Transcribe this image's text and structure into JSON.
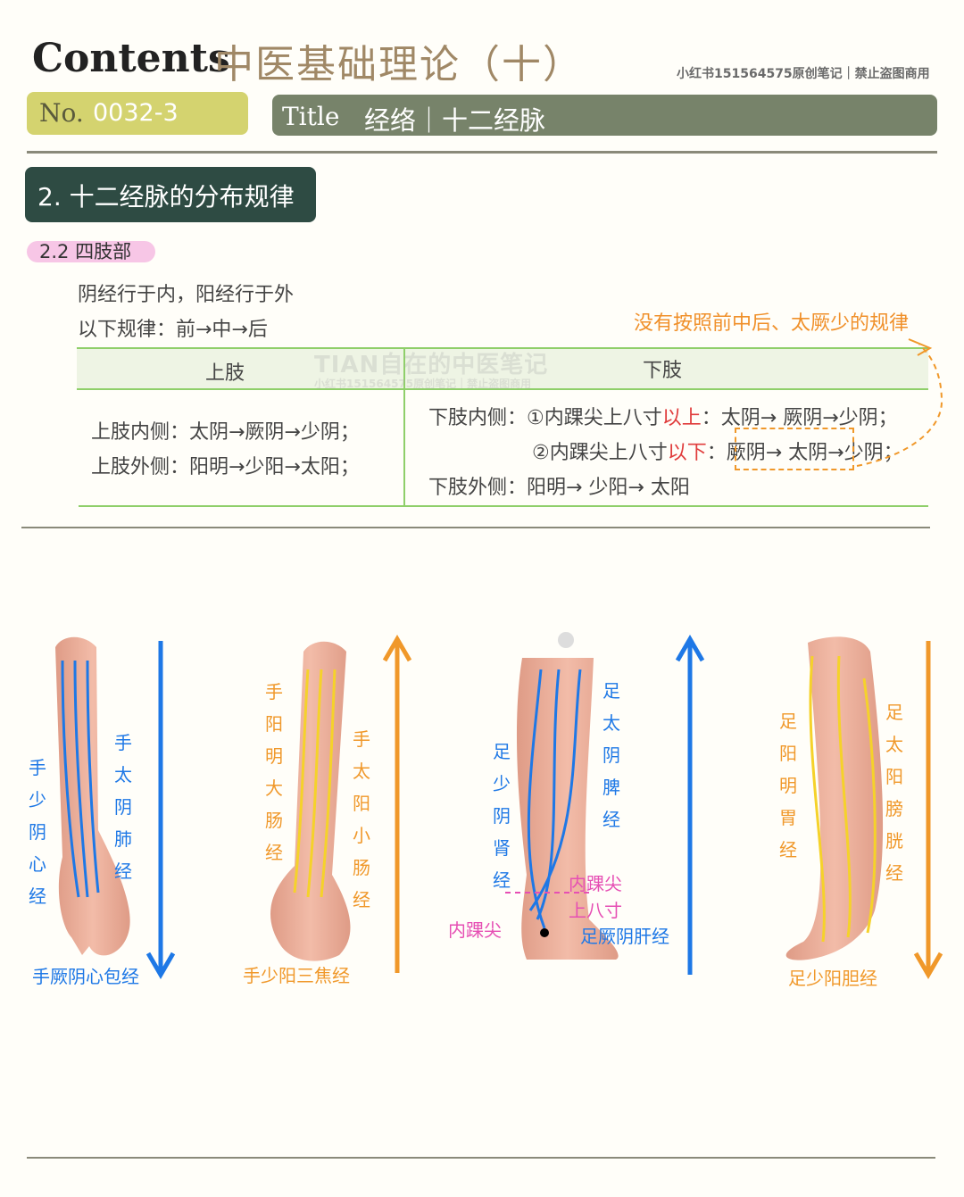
{
  "header": {
    "contents": "Contents",
    "main_title": "中医基础理论（十）",
    "credit": "小红书151564575原创笔记｜禁止盗图商用",
    "no_label": "No.",
    "no_value": "0032-3",
    "title_label": "Title",
    "title_value": "经络｜十二经脉"
  },
  "section": {
    "heading": "2.  十二经脉的分布规律",
    "sub": "2.2 四肢部"
  },
  "intro": {
    "line1": "阴经行于内，阳经行于外",
    "line2": "以下规律：前→中→后"
  },
  "note": "没有按照前中后、太厥少的规律",
  "watermark": {
    "line1": "TIAN自在的中医笔记",
    "line2": "小红书151564575原创笔记｜禁止盗图商用"
  },
  "table": {
    "col_upper": "上肢",
    "col_lower": "下肢",
    "upper_inner": "上肢内侧：太阴→厥阴→少阴；",
    "upper_outer": "上肢外侧：阳明→少阳→太阳；",
    "lower_inner_label": "下肢内侧：",
    "lower_inner_1a": "①内踝尖上八寸",
    "lower_inner_1b": "以上",
    "lower_inner_1c": "：太阴→ 厥阴→少阴；",
    "lower_inner_2a": "②内踝尖上八寸",
    "lower_inner_2b": "以下",
    "lower_inner_2c": "：厥阴→ 太阴→少阴；",
    "lower_outer": "下肢外侧：阳明→ 少阳→ 太阳"
  },
  "figure": {
    "arm1": {
      "left": "手少阴心经",
      "right": "手太阴肺经",
      "bottom": "手厥阴心包经"
    },
    "arm2": {
      "left": "手阳明大肠经",
      "right": "手太阳小肠经",
      "bottom": "手少阳三焦经"
    },
    "leg1": {
      "left": "足少阴肾经",
      "right": "足太阴脾经",
      "mark1": "内踝尖",
      "mark2": "上八寸",
      "ankle": "内踝尖",
      "bottom": "足厥阴肝经"
    },
    "leg2": {
      "left": "足阳明胃经",
      "right": "足太阳膀胱经",
      "bottom": "足少阳胆经"
    }
  },
  "colors": {
    "yin_blue": "#1e78e6",
    "yang_gold": "#f0982a",
    "section_bg": "#2e4b43",
    "title_bg": "#77836a",
    "no_bg": "#d4d36f"
  }
}
